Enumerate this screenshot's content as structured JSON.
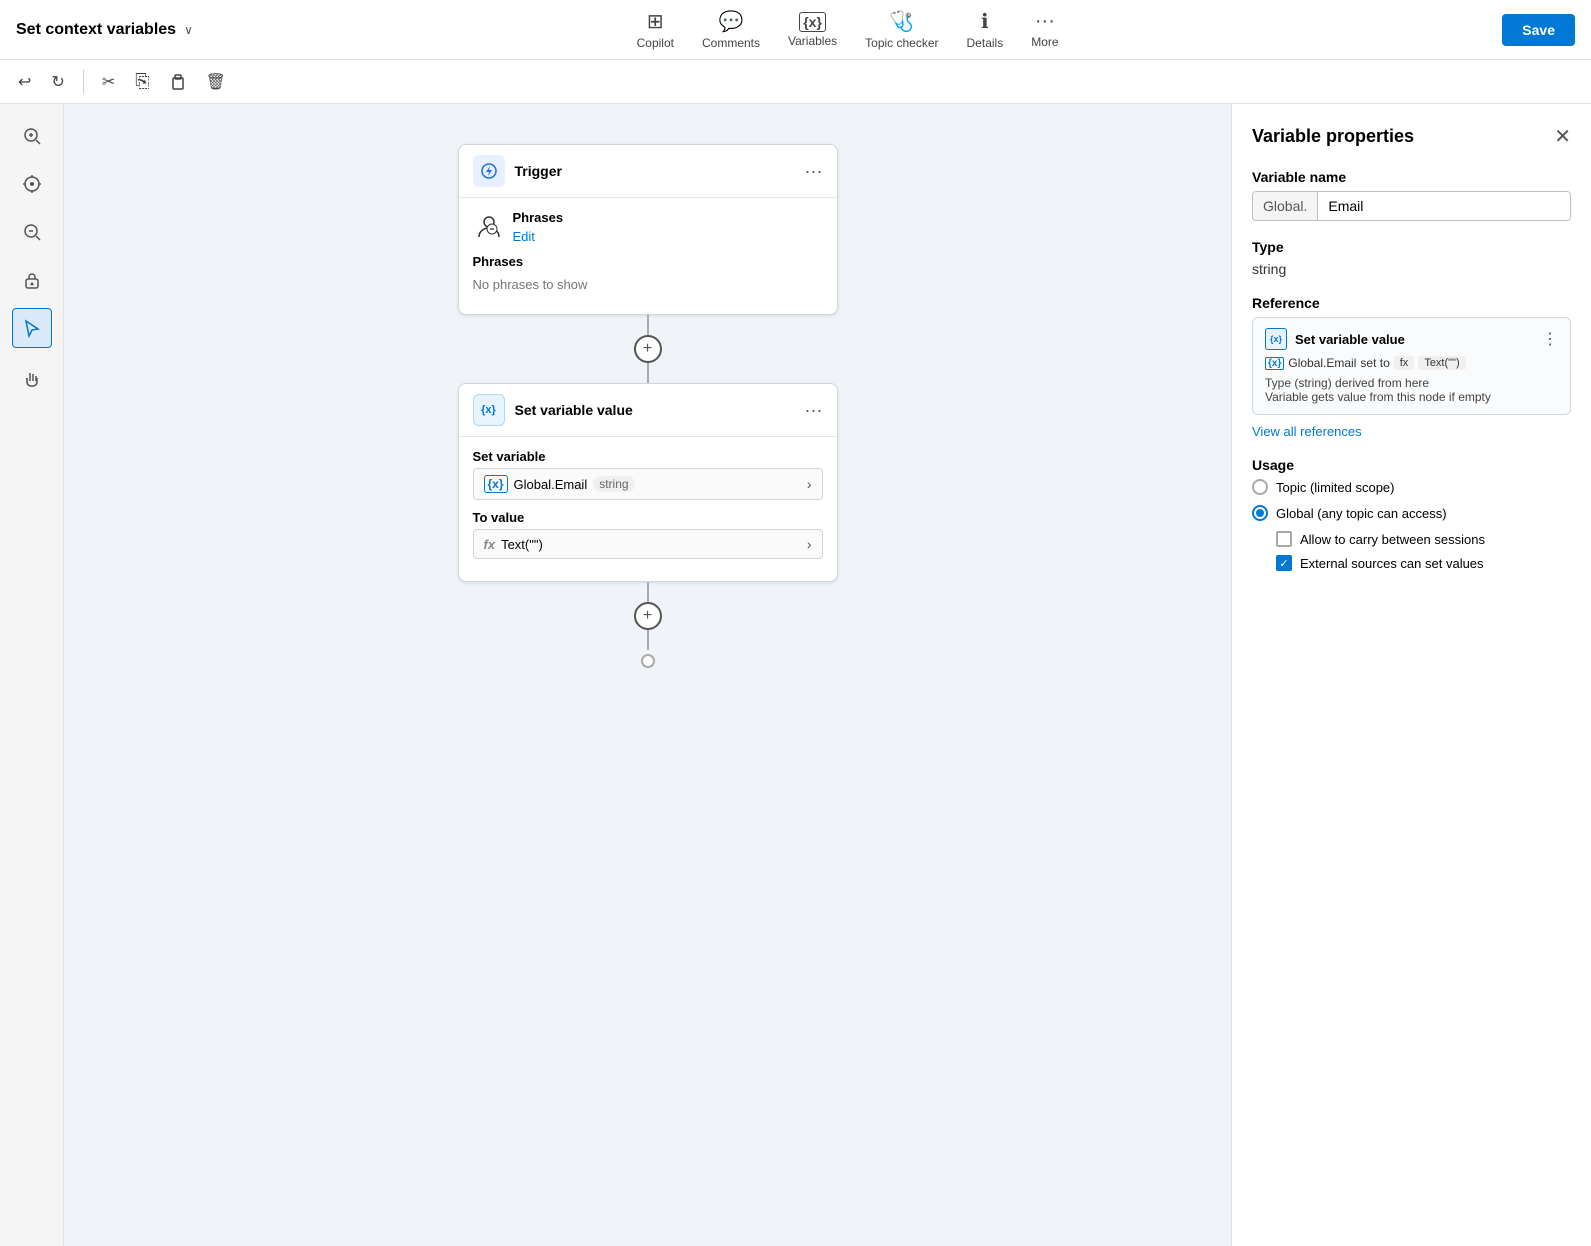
{
  "topbar": {
    "title": "Set context variables",
    "nav": [
      {
        "id": "copilot",
        "label": "Copilot",
        "icon": "⊞"
      },
      {
        "id": "comments",
        "label": "Comments",
        "icon": "💬"
      },
      {
        "id": "variables",
        "label": "Variables",
        "icon": "{x}"
      },
      {
        "id": "topic_checker",
        "label": "Topic checker",
        "icon": "🩺"
      },
      {
        "id": "details",
        "label": "Details",
        "icon": "ℹ"
      },
      {
        "id": "more",
        "label": "More",
        "icon": "···"
      }
    ],
    "save_label": "Save"
  },
  "toolbar": {
    "undo_label": "↩",
    "redo_label": "↻",
    "cut_label": "✂",
    "copy_label": "⎘",
    "paste_label": "⬜",
    "delete_label": "🗑"
  },
  "trigger_node": {
    "title": "Trigger",
    "phrases_label": "Phrases",
    "edit_label": "Edit",
    "phrases_section_title": "Phrases",
    "phrases_empty": "No phrases to show"
  },
  "variable_node": {
    "title": "Set variable value",
    "set_variable_label": "Set variable",
    "variable_icon": "{x}",
    "variable_name": "Global.Email",
    "variable_type": "string",
    "to_value_label": "To value",
    "to_value_icon": "fx",
    "to_value_text": "Text(\"\")"
  },
  "right_panel": {
    "title": "Variable properties",
    "variable_name_label": "Variable name",
    "variable_prefix": "Global.",
    "variable_name_value": "Email",
    "type_label": "Type",
    "type_value": "string",
    "reference_label": "Reference",
    "ref_title": "Set variable value",
    "ref_detail_icon": "{x}",
    "ref_detail_name": "Global.Email",
    "ref_set_to": "set to",
    "ref_fx": "fx",
    "ref_value": "Text(\"\")",
    "ref_note_line1": "Type (string) derived from here",
    "ref_note_line2": "Variable gets value from this node if empty",
    "view_all_label": "View all references",
    "usage_label": "Usage",
    "option_topic_label": "Topic (limited scope)",
    "option_global_label": "Global (any topic can access)",
    "checkbox1_label": "Allow to carry between sessions",
    "checkbox2_label": "External sources can set values"
  },
  "left_panel": {
    "zoom_in_icon": "zoom-in",
    "center_icon": "center",
    "zoom_out_icon": "zoom-out",
    "lock_icon": "lock",
    "cursor_icon": "cursor",
    "hand_icon": "hand"
  }
}
